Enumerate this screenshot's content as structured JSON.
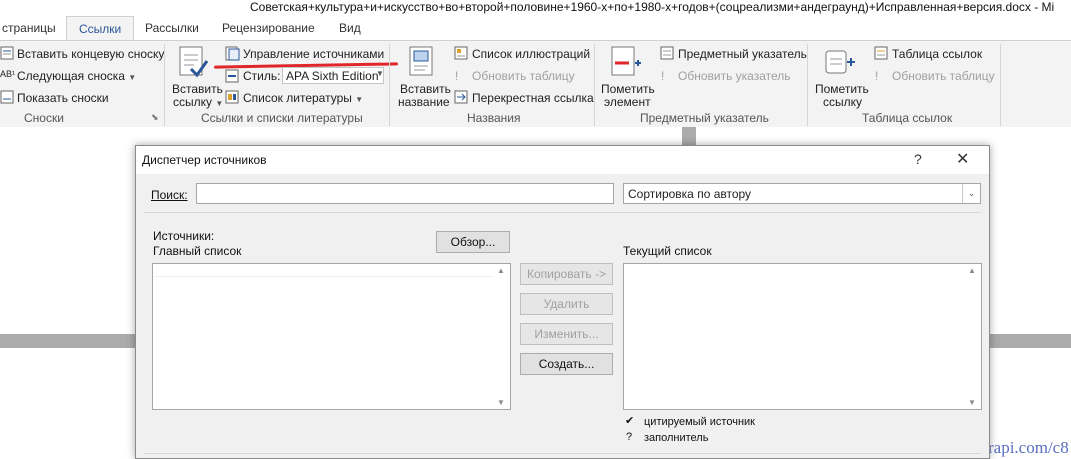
{
  "window": {
    "title": "Советская+культура+и+искусство+во+второй+половине+1960-х+по+1980-х+годов+(соцреализми+андеграунд)+Исправленная+версия.docx  -  Mi"
  },
  "tabs": [
    {
      "label": "страницы"
    },
    {
      "label": "Ссылки",
      "active": true
    },
    {
      "label": "Рассылки"
    },
    {
      "label": "Рецензирование"
    },
    {
      "label": "Вид"
    }
  ],
  "ribbon": {
    "footnotes": {
      "insert_endnote": "Вставить концевую сноску",
      "next_footnote": "Следующая сноска",
      "show_notes": "Показать сноски",
      "group_label": "Сноски"
    },
    "citations": {
      "insert_citation_line1": "Вставить",
      "insert_citation_line2": "ссылку",
      "manage_sources": "Управление источниками",
      "style_label": "Стиль:",
      "style_value": "APA Sixth Edition",
      "bibliography": "Список литературы",
      "group_label": "Ссылки и списки литературы"
    },
    "captions": {
      "insert_caption_line1": "Вставить",
      "insert_caption_line2": "название",
      "table_of_figures": "Список иллюстраций",
      "update_table": "Обновить таблицу",
      "cross_reference": "Перекрестная ссылка",
      "group_label": "Названия"
    },
    "index": {
      "mark_entry_line1": "Пометить",
      "mark_entry_line2": "элемент",
      "insert_index": "Предметный указатель",
      "update_index": "Обновить указатель",
      "group_label": "Предметный указатель"
    },
    "toa": {
      "mark_citation_line1": "Пометить",
      "mark_citation_line2": "ссылку",
      "insert_toa": "Таблица ссылок",
      "update_table": "Обновить таблицу",
      "group_label": "Таблица ссылок"
    }
  },
  "dialog": {
    "title": "Диспетчер источников",
    "help": "?",
    "close": "✕",
    "search_label": "Поиск:",
    "search_value": "",
    "sort_value": "Сортировка по автору",
    "sources_label": "Источники:",
    "master_list_label": "Главный список",
    "browse_button": "Обзор...",
    "current_list_label": "Текущий список",
    "copy_button": "Копировать ->",
    "delete_button": "Удалить",
    "edit_button": "Изменить...",
    "new_button": "Создать...",
    "legend_cited_symbol": "✔",
    "legend_cited": "цитируемый источник",
    "legend_placeholder_symbol": "?",
    "legend_placeholder": "заполнитель"
  },
  "watermark": {
    "text": "rapi.com/c8"
  },
  "colors": {
    "accent": "#2b579a",
    "highlight": "#e0262a"
  }
}
